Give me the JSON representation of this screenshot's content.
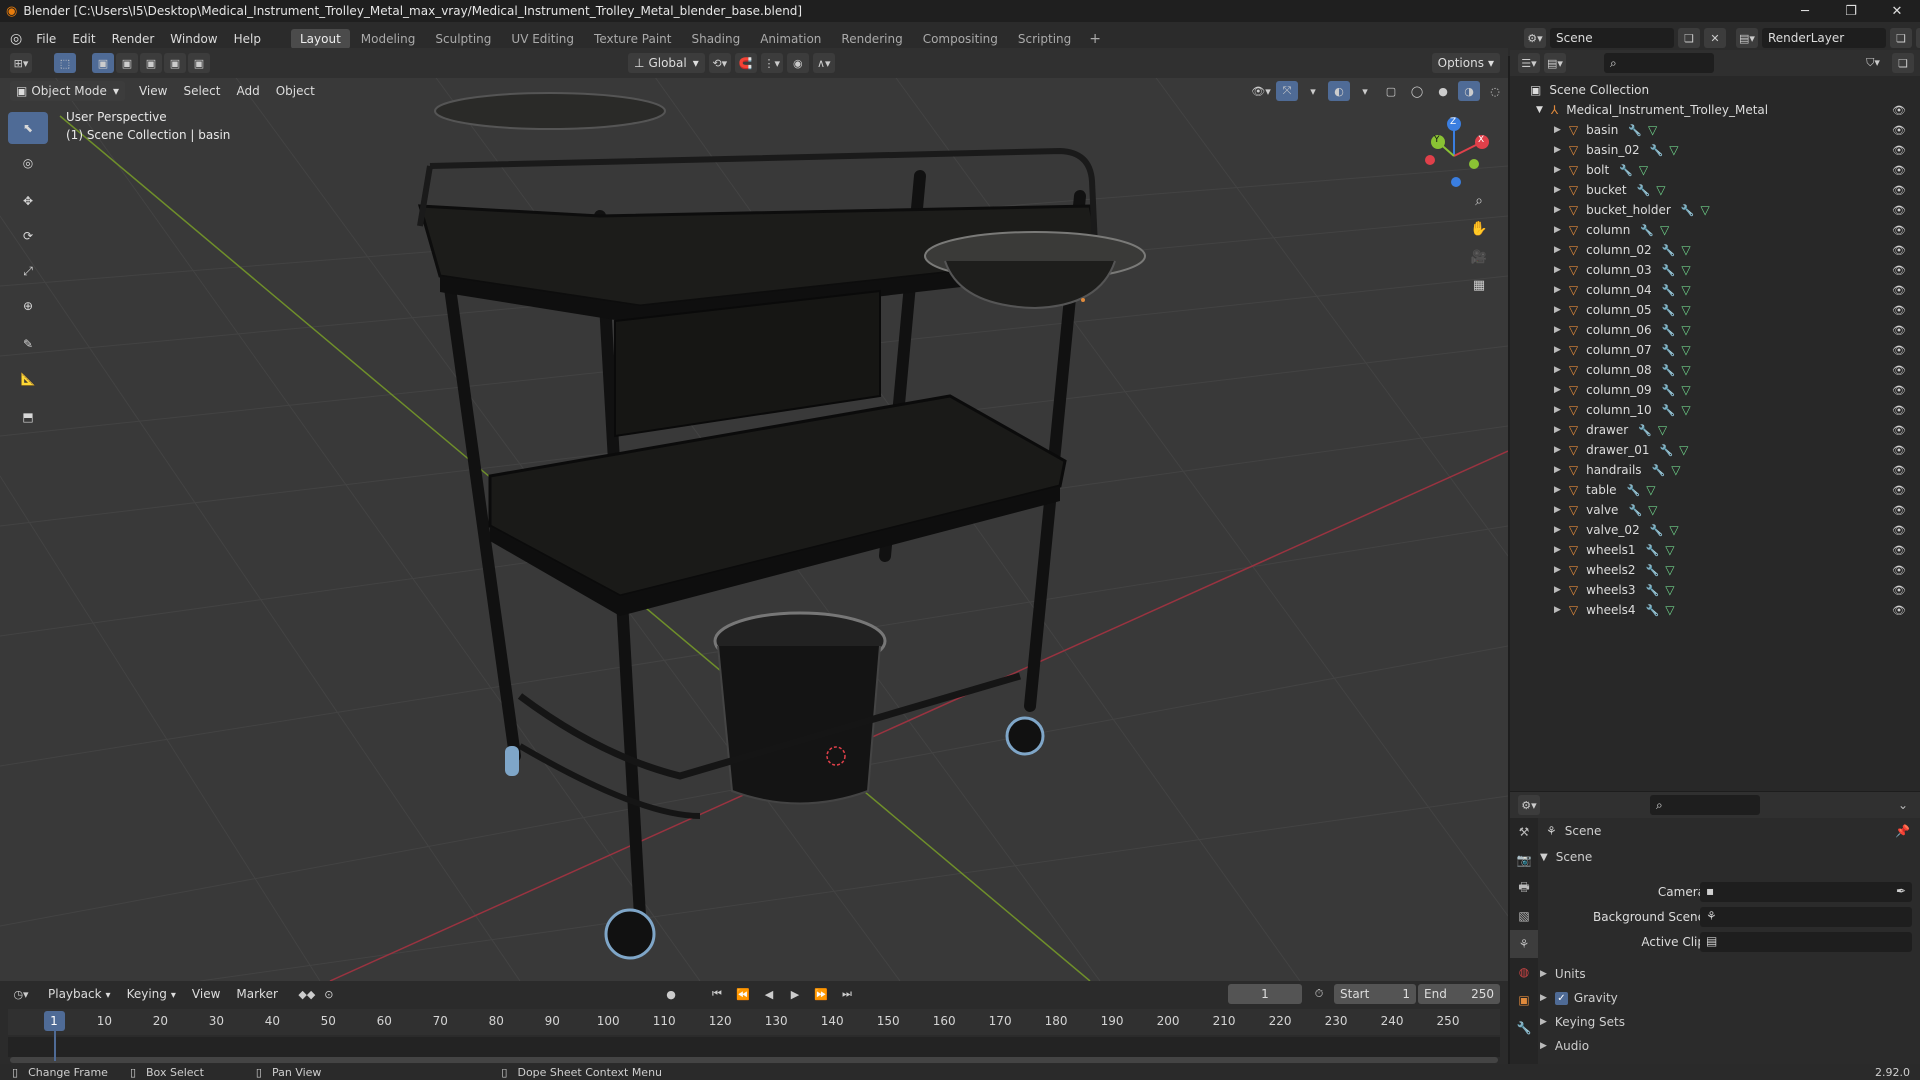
{
  "window": {
    "title": "Blender [C:\\Users\\I5\\Desktop\\Medical_Instrument_Trolley_Metal_max_vray/Medical_Instrument_Trolley_Metal_blender_base.blend]",
    "minimize": "─",
    "maximize": "❐",
    "close": "✕"
  },
  "menu": [
    "File",
    "Edit",
    "Render",
    "Window",
    "Help"
  ],
  "workspaces": [
    "Layout",
    "Modeling",
    "Sculpting",
    "UV Editing",
    "Texture Paint",
    "Shading",
    "Animation",
    "Rendering",
    "Compositing",
    "Scripting"
  ],
  "add_workspace": "+",
  "scene_selector": {
    "value": "Scene"
  },
  "renderlayer_selector": {
    "value": "RenderLayer"
  },
  "viewport_header": {
    "mode": "Object Mode",
    "menus": [
      "View",
      "Select",
      "Add",
      "Object"
    ],
    "transform_orientation": "Global",
    "options": "Options"
  },
  "viewport_overlay": {
    "perspective": "User Perspective",
    "collection_info": "(1) Scene Collection | basin"
  },
  "gizmo": {
    "x": "X",
    "y": "Y",
    "z": "Z"
  },
  "outliner": {
    "root": "Scene Collection",
    "collection": "Medical_Instrument_Trolley_Metal",
    "objects": [
      "basin",
      "basin_02",
      "bolt",
      "bucket",
      "bucket_holder",
      "column",
      "column_02",
      "column_03",
      "column_04",
      "column_05",
      "column_06",
      "column_07",
      "column_08",
      "column_09",
      "column_10",
      "drawer",
      "drawer_01",
      "handrails",
      "table",
      "valve",
      "valve_02",
      "wheels1",
      "wheels2",
      "wheels3",
      "wheels4"
    ]
  },
  "properties": {
    "header": "Scene",
    "panel": "Scene",
    "camera_label": "Camera",
    "background_scene_label": "Background Scene",
    "active_clip_label": "Active Clip",
    "sections": [
      "Units",
      "Gravity",
      "Keying Sets",
      "Audio"
    ],
    "gravity_checked": true
  },
  "timeline": {
    "menus": [
      "Playback",
      "Keying",
      "View",
      "Marker"
    ],
    "current_frame": "1",
    "start_label": "Start",
    "start_value": "1",
    "end_label": "End",
    "end_value": "250",
    "ruler": [
      "1",
      "10",
      "20",
      "30",
      "40",
      "50",
      "60",
      "70",
      "80",
      "90",
      "100",
      "110",
      "120",
      "130",
      "140",
      "150",
      "160",
      "170",
      "180",
      "190",
      "200",
      "210",
      "220",
      "230",
      "240",
      "250"
    ]
  },
  "statusbar": {
    "change_frame": "Change Frame",
    "box_select": "Box Select",
    "pan_view": "Pan View",
    "context_menu": "Dope Sheet Context Menu",
    "version": "2.92.0"
  },
  "colors": {
    "accent": "#4f6b96",
    "object_orange": "#e08a3c",
    "mesh_green": "#6fd28a",
    "modifier_blue": "#7fa6e0",
    "axis_x": "#e0404a",
    "axis_y": "#8ac234",
    "axis_z": "#3a7ee0"
  }
}
